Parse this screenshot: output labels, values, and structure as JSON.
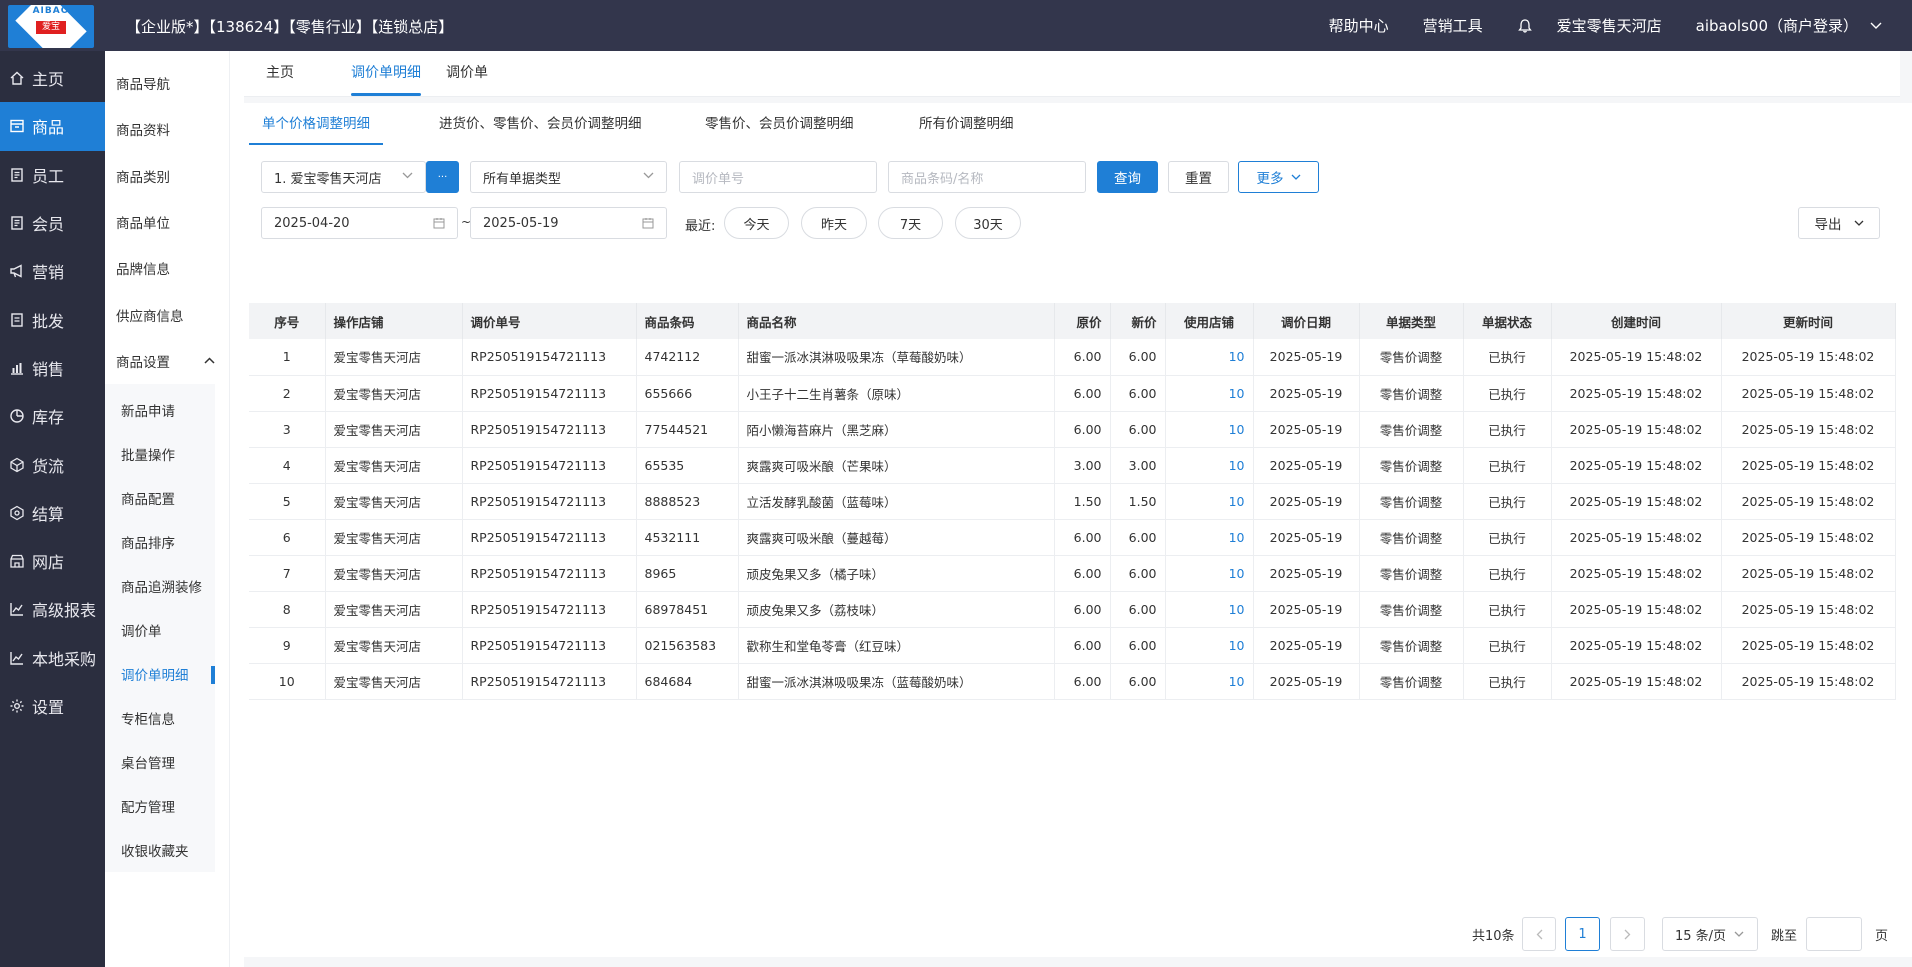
{
  "topbar": {
    "logo_text": "AIBAO",
    "logo_sub": "爱宝",
    "title": "【企业版*】【138624】【零售行业】【连锁总店】",
    "help": "帮助中心",
    "marketing_tools": "营销工具",
    "store": "爱宝零售天河店",
    "user": "aibaols00（商户登录）"
  },
  "leftnav": [
    {
      "label": "主页",
      "icon": "home-icon"
    },
    {
      "label": "商品",
      "icon": "goods-icon"
    },
    {
      "label": "员工",
      "icon": "staff-icon"
    },
    {
      "label": "会员",
      "icon": "member-icon"
    },
    {
      "label": "营销",
      "icon": "megaphone-icon"
    },
    {
      "label": "批发",
      "icon": "wholesale-icon"
    },
    {
      "label": "销售",
      "icon": "sales-chart-icon"
    },
    {
      "label": "库存",
      "icon": "stock-icon"
    },
    {
      "label": "货流",
      "icon": "flow-icon"
    },
    {
      "label": "结算",
      "icon": "settle-icon"
    },
    {
      "label": "网店",
      "icon": "shop-icon"
    },
    {
      "label": "高级报表",
      "icon": "report-icon"
    },
    {
      "label": "本地采购",
      "icon": "purchase-icon"
    },
    {
      "label": "设置",
      "icon": "gear-icon"
    }
  ],
  "subnav": {
    "items": [
      "商品导航",
      "商品资料",
      "商品类别",
      "商品单位",
      "品牌信息",
      "供应商信息"
    ],
    "group": "商品设置",
    "children": [
      "新品申请",
      "批量操作",
      "商品配置",
      "商品排序",
      "商品追溯装修",
      "调价单",
      "调价单明细",
      "专柜信息",
      "桌台管理",
      "配方管理",
      "收银收藏夹"
    ]
  },
  "tabs": [
    "主页",
    "调价单明细",
    "调价单"
  ],
  "subtabs": [
    "单个价格调整明细",
    "进货价、零售价、会员价调整明细",
    "零售价、会员价调整明细",
    "所有价调整明细"
  ],
  "filters": {
    "store_select": "1. 爱宝零售天河店",
    "more_dots": "···",
    "doc_type": "所有单据类型",
    "doc_no_placeholder": "调价单号",
    "goods_placeholder": "商品条码/名称",
    "query": "查询",
    "reset": "重置",
    "more": "更多",
    "date_from": "2025-04-20",
    "date_to": "2025-05-19",
    "date_sep": "~",
    "recent_label": "最近:",
    "today": "今天",
    "yesterday": "昨天",
    "days7": "7天",
    "days30": "30天",
    "export": "导出"
  },
  "table": {
    "headers": [
      "序号",
      "操作店铺",
      "调价单号",
      "商品条码",
      "商品名称",
      "原价",
      "新价",
      "使用店铺",
      "调价日期",
      "单据类型",
      "单据状态",
      "创建时间",
      "更新时间"
    ],
    "rows": [
      [
        "1",
        "爱宝零售天河店",
        "RP250519154721113",
        "4742112",
        "甜蜜一派冰淇淋吸吸果冻（草莓酸奶味）",
        "6.00",
        "6.00",
        "10",
        "2025-05-19",
        "零售价调整",
        "已执行",
        "2025-05-19 15:48:02",
        "2025-05-19 15:48:02"
      ],
      [
        "2",
        "爱宝零售天河店",
        "RP250519154721113",
        "655666",
        "小王子十二生肖薯条（原味）",
        "6.00",
        "6.00",
        "10",
        "2025-05-19",
        "零售价调整",
        "已执行",
        "2025-05-19 15:48:02",
        "2025-05-19 15:48:02"
      ],
      [
        "3",
        "爱宝零售天河店",
        "RP250519154721113",
        "77544521",
        "陌小懒海苔麻片（黑芝麻）",
        "6.00",
        "6.00",
        "10",
        "2025-05-19",
        "零售价调整",
        "已执行",
        "2025-05-19 15:48:02",
        "2025-05-19 15:48:02"
      ],
      [
        "4",
        "爱宝零售天河店",
        "RP250519154721113",
        "65535",
        "爽露爽可吸米酿（芒果味）",
        "3.00",
        "3.00",
        "10",
        "2025-05-19",
        "零售价调整",
        "已执行",
        "2025-05-19 15:48:02",
        "2025-05-19 15:48:02"
      ],
      [
        "5",
        "爱宝零售天河店",
        "RP250519154721113",
        "8888523",
        "立活发酵乳酸菌（蓝莓味）",
        "1.50",
        "1.50",
        "10",
        "2025-05-19",
        "零售价调整",
        "已执行",
        "2025-05-19 15:48:02",
        "2025-05-19 15:48:02"
      ],
      [
        "6",
        "爱宝零售天河店",
        "RP250519154721113",
        "4532111",
        "爽露爽可吸米酿（蔓越莓）",
        "6.00",
        "6.00",
        "10",
        "2025-05-19",
        "零售价调整",
        "已执行",
        "2025-05-19 15:48:02",
        "2025-05-19 15:48:02"
      ],
      [
        "7",
        "爱宝零售天河店",
        "RP250519154721113",
        "8965",
        "顽皮兔果又多（橘子味）",
        "6.00",
        "6.00",
        "10",
        "2025-05-19",
        "零售价调整",
        "已执行",
        "2025-05-19 15:48:02",
        "2025-05-19 15:48:02"
      ],
      [
        "8",
        "爱宝零售天河店",
        "RP250519154721113",
        "68978451",
        "顽皮兔果又多（荔枝味）",
        "6.00",
        "6.00",
        "10",
        "2025-05-19",
        "零售价调整",
        "已执行",
        "2025-05-19 15:48:02",
        "2025-05-19 15:48:02"
      ],
      [
        "9",
        "爱宝零售天河店",
        "RP250519154721113",
        "021563583",
        "歡称生和堂龟苓膏（红豆味）",
        "6.00",
        "6.00",
        "10",
        "2025-05-19",
        "零售价调整",
        "已执行",
        "2025-05-19 15:48:02",
        "2025-05-19 15:48:02"
      ],
      [
        "10",
        "爱宝零售天河店",
        "RP250519154721113",
        "684684",
        "甜蜜一派冰淇淋吸吸果冻（蓝莓酸奶味）",
        "6.00",
        "6.00",
        "10",
        "2025-05-19",
        "零售价调整",
        "已执行",
        "2025-05-19 15:48:02",
        "2025-05-19 15:48:02"
      ]
    ]
  },
  "pager": {
    "total": "共10条",
    "current_page": "1",
    "page_size": "15 条/页",
    "jump_label": "跳至",
    "page_suffix": "页"
  },
  "colors": {
    "accent": "#1f7fd6",
    "topbar": "#33364c",
    "leftnav": "#2b2e3f"
  }
}
